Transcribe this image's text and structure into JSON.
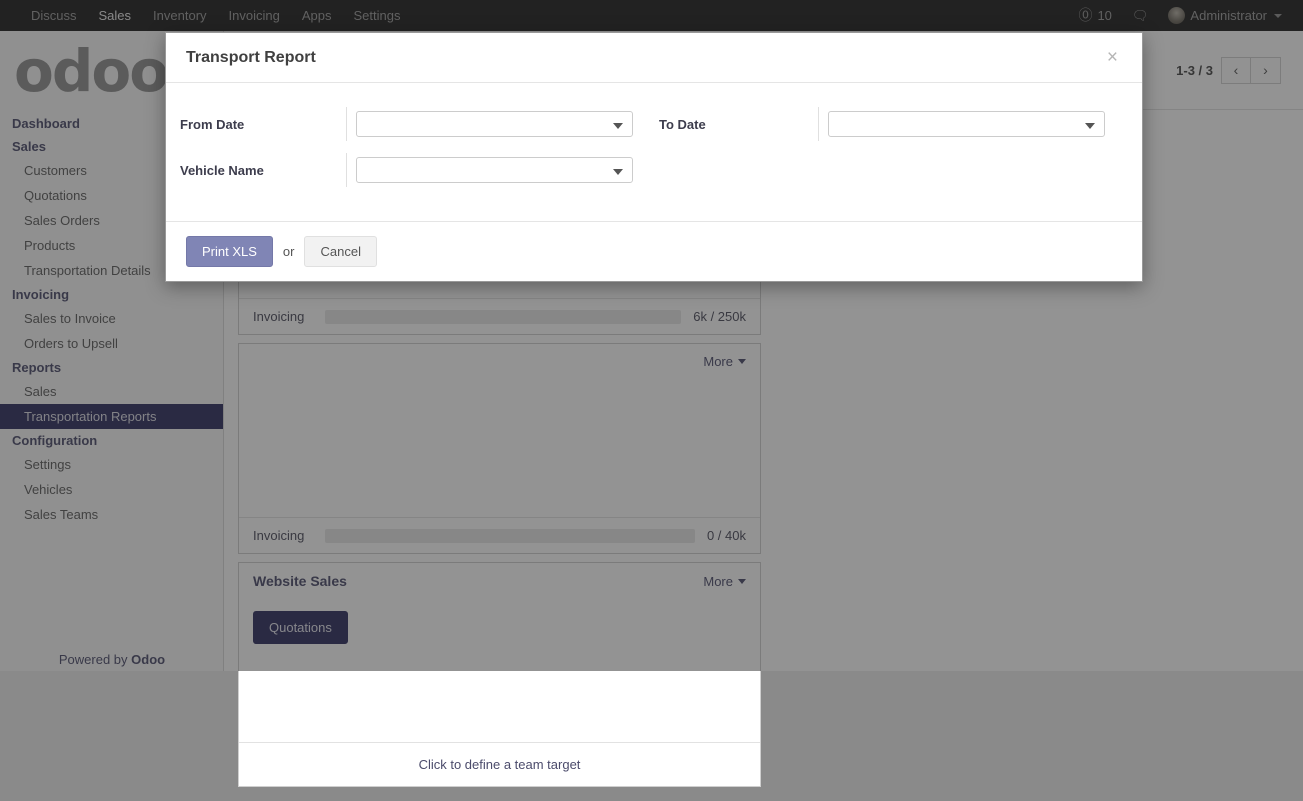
{
  "navbar": {
    "menu_items": [
      {
        "label": "Discuss",
        "active": false
      },
      {
        "label": "Sales",
        "active": true
      },
      {
        "label": "Inventory",
        "active": false
      },
      {
        "label": "Invoicing",
        "active": false
      },
      {
        "label": "Apps",
        "active": false
      },
      {
        "label": "Settings",
        "active": false
      }
    ],
    "mention_icon": "at-icon",
    "mention_count": "10",
    "chat_icon": "chat-bubble-icon",
    "avatar_icon": "user-avatar",
    "user_name": "Administrator",
    "user_caret_icon": "caret-down-icon"
  },
  "sidebar": {
    "logo_text": "odoo",
    "groups": [
      {
        "section": "Dashboard",
        "items": []
      },
      {
        "section": "Sales",
        "items": [
          {
            "label": "Customers",
            "active": false
          },
          {
            "label": "Quotations",
            "active": false
          },
          {
            "label": "Sales Orders",
            "active": false
          },
          {
            "label": "Products",
            "active": false
          },
          {
            "label": "Transportation Details",
            "active": false
          }
        ]
      },
      {
        "section": "Invoicing",
        "items": [
          {
            "label": "Sales to Invoice",
            "active": false
          },
          {
            "label": "Orders to Upsell",
            "active": false
          }
        ]
      },
      {
        "section": "Reports",
        "items": [
          {
            "label": "Sales",
            "active": false
          },
          {
            "label": "Transportation Reports",
            "active": true
          }
        ]
      },
      {
        "section": "Configuration",
        "items": [
          {
            "label": "Settings",
            "active": false
          },
          {
            "label": "Vehicles",
            "active": false
          },
          {
            "label": "Sales Teams",
            "active": false
          }
        ]
      }
    ],
    "powered_prefix": "Powered by ",
    "powered_brand": "Odoo"
  },
  "control_bar": {
    "pager_count": "1-3 / 3",
    "prev_icon": "chevron-left-icon",
    "prev_label": "‹",
    "next_icon": "chevron-right-icon",
    "next_label": "›"
  },
  "dashboard": {
    "more_label": "More",
    "cards": [
      {
        "title": "",
        "quotations_label": "",
        "progress_label": "Invoicing",
        "progress_value": "6k / 250k",
        "progress_percent": 2.4,
        "footer": ""
      },
      {
        "title": "",
        "quotations_label": "",
        "progress_label": "Invoicing",
        "progress_value": "0 / 40k",
        "progress_percent": 0,
        "footer": ""
      },
      {
        "title": "Website Sales",
        "quotations_label": "Quotations",
        "progress_label": "",
        "progress_value": "",
        "progress_percent": 0,
        "footer": "Click to define a team target"
      }
    ]
  },
  "modal": {
    "title": "Transport Report",
    "close_icon": "close-icon",
    "close_label": "×",
    "fields": {
      "from_date_label": "From Date",
      "from_date_value": "",
      "to_date_label": "To Date",
      "to_date_value": "",
      "vehicle_name_label": "Vehicle Name",
      "vehicle_name_value": ""
    },
    "dropdown_icon": "caret-down-icon",
    "print_label": "Print XLS",
    "or_label": "or",
    "cancel_label": "Cancel"
  },
  "colors": {
    "navbar_bg": "#1c1c1c",
    "primary_button": "#8085b5",
    "accent_dark": "#2d2d5e",
    "sidebar_active_bg": "#2d2d5e",
    "label_text": "#4b4b6b"
  }
}
